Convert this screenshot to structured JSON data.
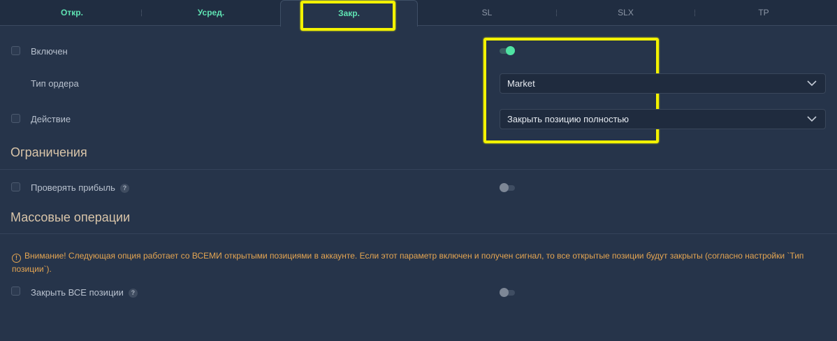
{
  "tabs": [
    {
      "label": "Откр."
    },
    {
      "label": "Усред."
    },
    {
      "label": "Закр."
    },
    {
      "label": "SL"
    },
    {
      "label": "SLX"
    },
    {
      "label": "TP"
    }
  ],
  "close": {
    "enabled_label": "Включен",
    "enabled": true,
    "order_type_label": "Тип ордера",
    "order_type_value": "Market",
    "action_label": "Действие",
    "action_value": "Закрыть позицию полностью"
  },
  "limits": {
    "title": "Ограничения",
    "check_profit_label": "Проверять прибыль",
    "check_profit_enabled": false,
    "help": "?"
  },
  "mass": {
    "title": "Массовые операции",
    "warning_icon": "!",
    "warning_text": "Внимание! Следующая опция работает со ВСЕМИ открытыми позициями в аккаунте. Если этот параметр включен и получен сигнал, то все открытые позиции будут закрыты (согласно настройки `Тип позиции`).",
    "close_all_label": "Закрыть ВСЕ позиции",
    "close_all_enabled": false,
    "help": "?"
  },
  "colors": {
    "background": "#26344a",
    "accent_green": "#5fe3b3",
    "section_title": "#d9c5a9",
    "warning": "#e4a552",
    "highlight": "#f3f200"
  }
}
